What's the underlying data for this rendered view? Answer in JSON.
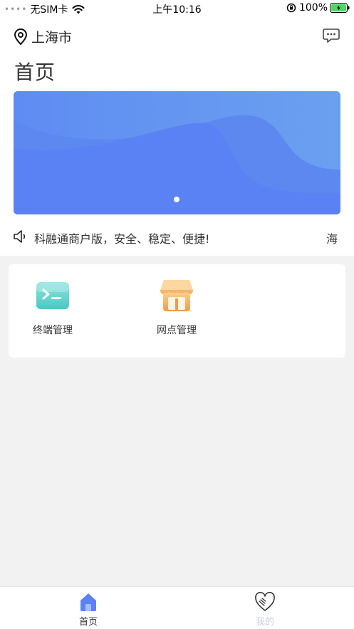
{
  "status_bar": {
    "signal": "••••",
    "carrier": "无SIM卡",
    "time": "上午10:16",
    "battery": "100%"
  },
  "header": {
    "location": "上海市",
    "title": "首页"
  },
  "banner": {
    "active_slide": 1,
    "slide_count": 1
  },
  "notice": {
    "text": "科融通商户版，安全、稳定、便捷!",
    "scroll_text": "海"
  },
  "menu": {
    "items": [
      {
        "label": "终端管理",
        "icon": "terminal-icon"
      },
      {
        "label": "网点管理",
        "icon": "store-icon"
      }
    ]
  },
  "tabbar": {
    "tabs": [
      {
        "label": "首页",
        "icon": "home-icon",
        "active": true
      },
      {
        "label": "我的",
        "icon": "heart-icon",
        "active": false
      }
    ]
  },
  "colors": {
    "accent": "#5b82f4",
    "banner": "#5a86f0",
    "inactive_tab": "#c9cfdb",
    "background": "#f2f2f2"
  }
}
